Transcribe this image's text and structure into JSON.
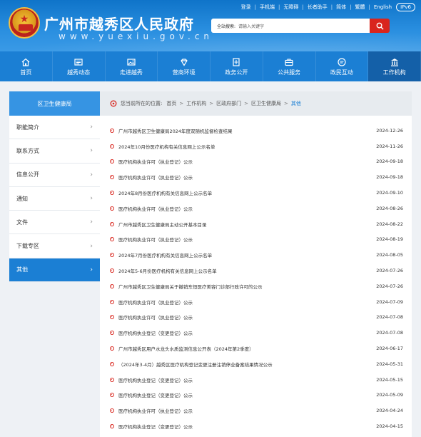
{
  "header": {
    "site_title": "广州市越秀区人民政府",
    "site_subtitle": "www.yuexiu.gov.cn",
    "toplinks": [
      "登录",
      "手机端",
      "无障碍",
      "长者助手",
      "简体",
      "繁體",
      "English"
    ],
    "ipv6": "IPv6",
    "search": {
      "label": "全站搜索:",
      "placeholder": "请输入关键字"
    }
  },
  "nav": [
    {
      "label": "首页",
      "icon": "home-icon"
    },
    {
      "label": "越秀动态",
      "icon": "news-icon"
    },
    {
      "label": "走进越秀",
      "icon": "picture-icon"
    },
    {
      "label": "营商环境",
      "icon": "diamond-icon"
    },
    {
      "label": "政务公开",
      "icon": "document-icon"
    },
    {
      "label": "公共服务",
      "icon": "briefcase-icon"
    },
    {
      "label": "政民互动",
      "icon": "chat-icon"
    },
    {
      "label": "工作机构",
      "icon": "building-icon"
    }
  ],
  "sidebar": {
    "heading": "区卫生健康局",
    "items": [
      {
        "label": "职能简介"
      },
      {
        "label": "联系方式"
      },
      {
        "label": "信息公开"
      },
      {
        "label": "通知"
      },
      {
        "label": "文件"
      },
      {
        "label": "下载专区"
      },
      {
        "label": "其他"
      }
    ]
  },
  "breadcrumb": {
    "prefix": "您当前所在的位置:",
    "items": [
      "首页",
      "工作机构",
      "区政府部门",
      "区卫生健康局",
      "其他"
    ]
  },
  "articles": [
    {
      "title": "广州市越秀区卫生健康局2024年度双随机监督检查结果",
      "date": "2024-12-26"
    },
    {
      "title": "2024年10月份医疗机构有关信息网上公示名单",
      "date": "2024-11-26"
    },
    {
      "title": "医疗机构执业许可（执业登记）公示",
      "date": "2024-09-18"
    },
    {
      "title": "医疗机构执业许可（执业登记）公示",
      "date": "2024-09-18"
    },
    {
      "title": "2024年8月份医疗机构有关信息网上公示名单",
      "date": "2024-09-10"
    },
    {
      "title": "医疗机构执业许可（执业登记）公示",
      "date": "2024-08-26"
    },
    {
      "title": "广州市越秀区卫生健康局主动公开基本目录",
      "date": "2024-08-22"
    },
    {
      "title": "医疗机构执业许可（执业登记）公示",
      "date": "2024-08-19"
    },
    {
      "title": "2024年7月份医疗机构有关信息网上公示名单",
      "date": "2024-08-05"
    },
    {
      "title": "2024年5-6月份医疗机构有关信息网上公示名单",
      "date": "2024-07-26"
    },
    {
      "title": "广州市越秀区卫生健康局关于撤销东恒医疗美容门诊部行政许可的公示",
      "date": "2024-07-26"
    },
    {
      "title": "医疗机构执业许可（执业登记）公示",
      "date": "2024-07-09"
    },
    {
      "title": "医疗机构执业许可（执业登记）公示",
      "date": "2024-07-08"
    },
    {
      "title": "医疗机构执业登记（变更登记）公示",
      "date": "2024-07-08"
    },
    {
      "title": "广州市越秀区用户水龙头水质监测信息公开表（2024年第2季度）",
      "date": "2024-06-17"
    },
    {
      "title": "（2024年3-4月）越秀区医疗机构登记变更注册注销停业备案结果情况公示",
      "date": "2024-05-31"
    },
    {
      "title": "医疗机构执业登记（变更登记）公示",
      "date": "2024-05-15"
    },
    {
      "title": "医疗机构执业登记（变更登记）公示",
      "date": "2024-05-09"
    },
    {
      "title": "医疗机构执业许可（执业登记）公示",
      "date": "2024-04-24"
    },
    {
      "title": "医疗机构执业登记（变更登记）公示",
      "date": "2024-04-15"
    }
  ]
}
